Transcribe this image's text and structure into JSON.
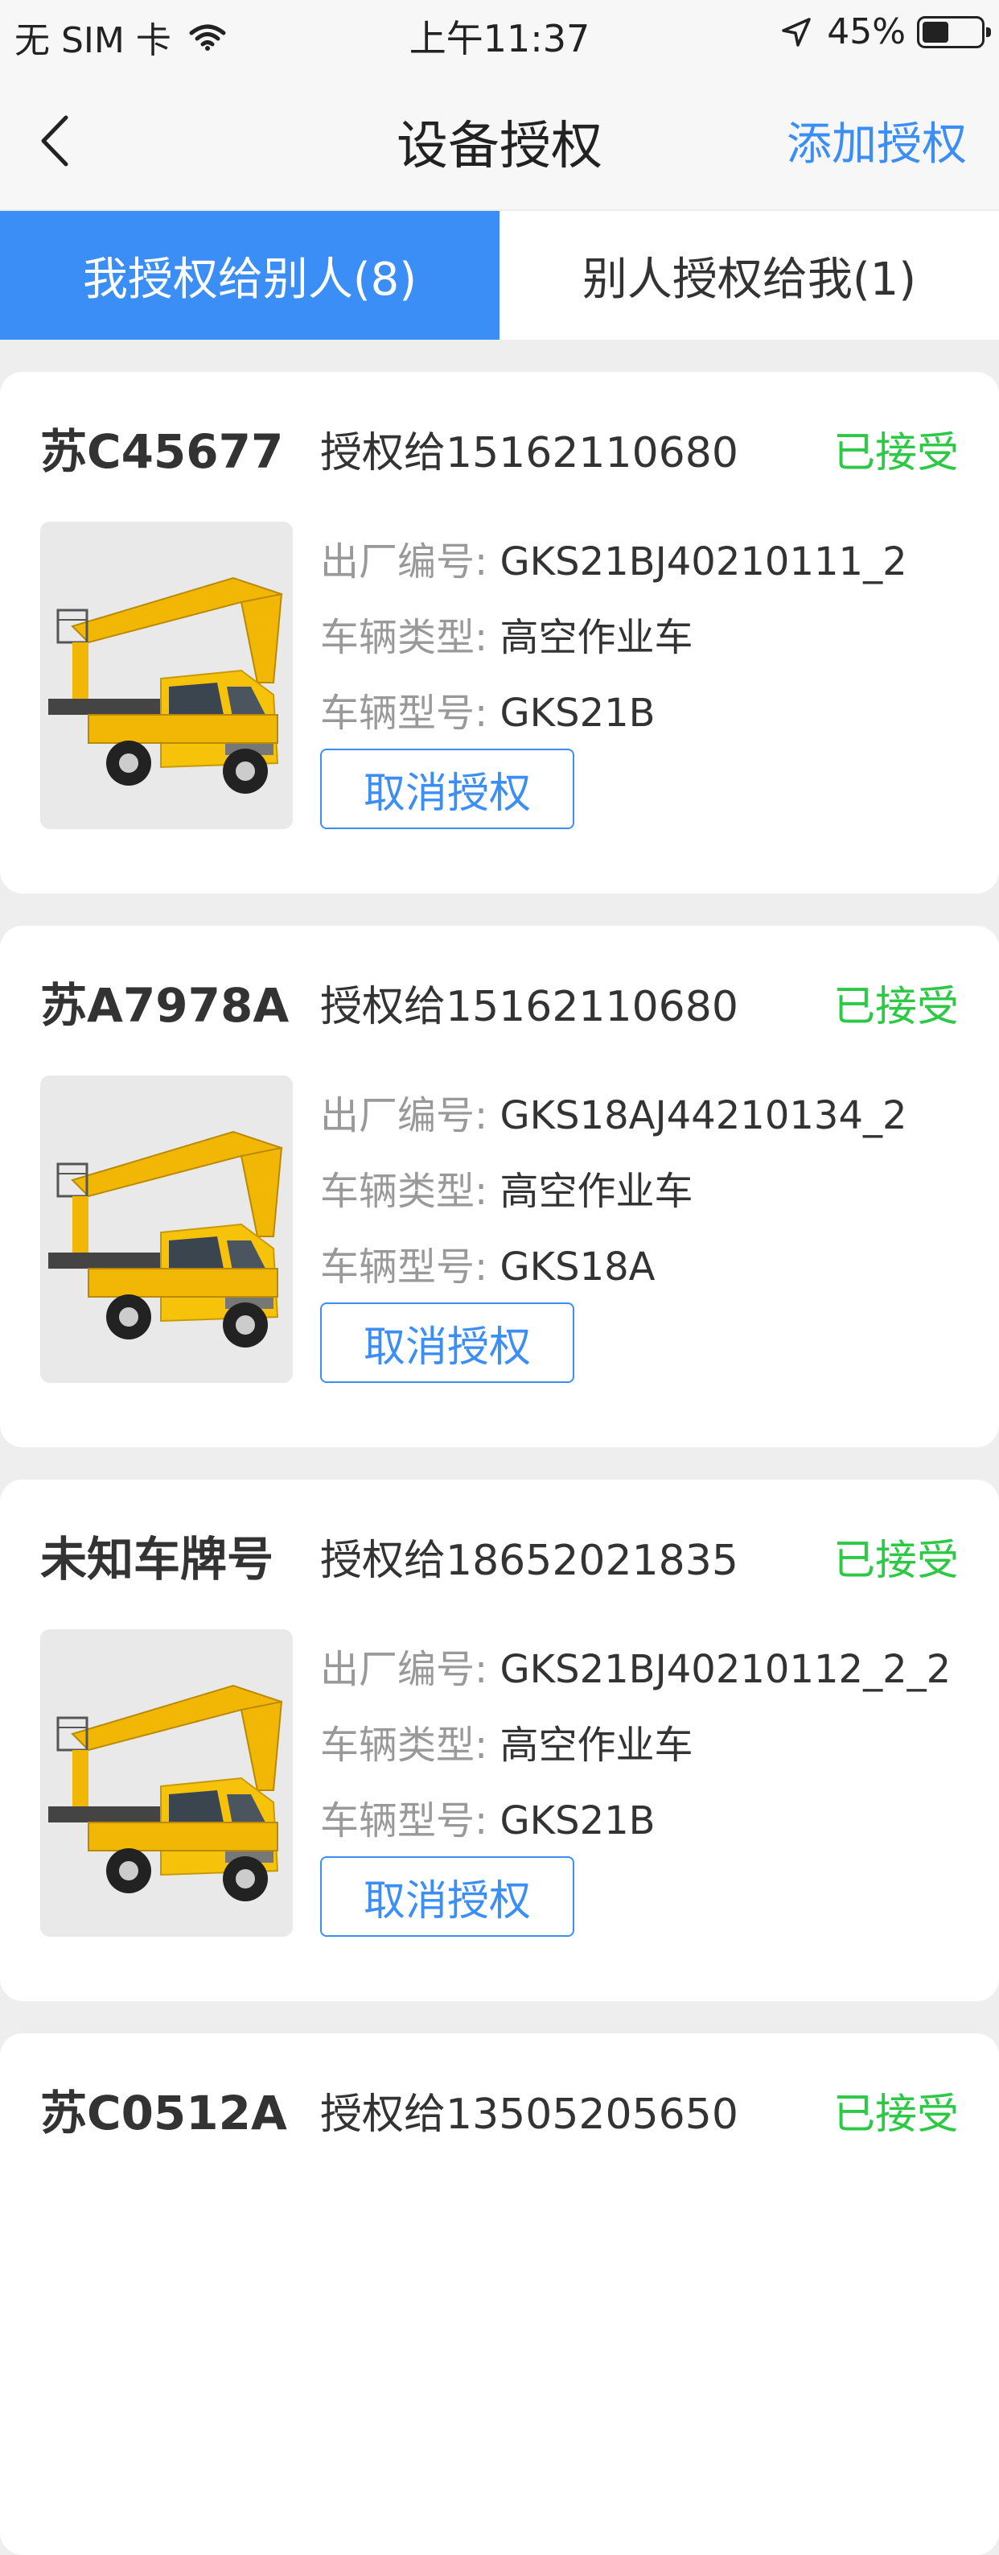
{
  "status_bar": {
    "carrier": "无 SIM 卡",
    "time": "上午11:37",
    "battery": "45%"
  },
  "nav": {
    "title": "设备授权",
    "action": "添加授权"
  },
  "tabs": [
    {
      "label": "我授权给别人(8)",
      "active": true
    },
    {
      "label": "别人授权给我(1)",
      "active": false
    }
  ],
  "labels": {
    "serial": "出厂编号:",
    "type": "车辆类型:",
    "model": "车辆型号:",
    "cancel": "取消授权"
  },
  "cards": [
    {
      "plate": "苏C45677",
      "auth_to": "授权给15162110680",
      "status": "已接受",
      "serial": "GKS21BJ40210111_2",
      "type": "高空作业车",
      "model": "GKS21B"
    },
    {
      "plate": "苏A7978A",
      "auth_to": "授权给15162110680",
      "status": "已接受",
      "serial": "GKS18AJ44210134_2",
      "type": "高空作业车",
      "model": "GKS18A"
    },
    {
      "plate": "未知车牌号",
      "auth_to": "授权给18652021835",
      "status": "已接受",
      "serial": "GKS21BJ40210112_2_2",
      "type": "高空作业车",
      "model": "GKS21B"
    },
    {
      "plate": "苏C0512A",
      "auth_to": "授权给13505205650",
      "status": "已接受"
    }
  ],
  "colors": {
    "accent": "#3b8ef5",
    "accepted": "#2dc845",
    "truck": "#f2b705"
  }
}
